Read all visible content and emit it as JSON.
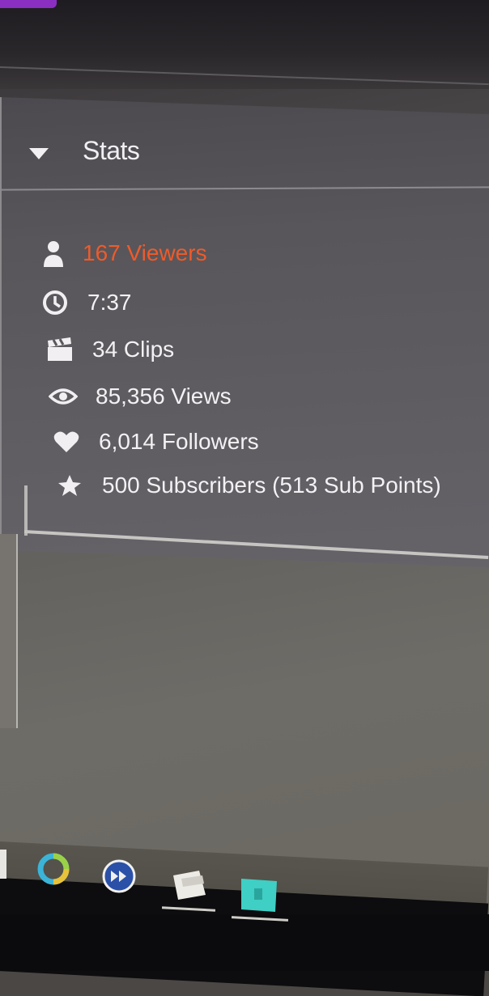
{
  "panel": {
    "title": "Stats",
    "toggle_icon": "caret-down-icon"
  },
  "stats": {
    "viewers": {
      "label": "167 Viewers",
      "icon": "person-icon",
      "color": "#f05a2a"
    },
    "uptime": {
      "label": "7:37",
      "icon": "clock-icon"
    },
    "clips": {
      "label": "34 Clips",
      "icon": "clapperboard-icon"
    },
    "views": {
      "label": "85,356 Views",
      "icon": "eye-icon"
    },
    "followers": {
      "label": "6,014 Followers",
      "icon": "heart-icon"
    },
    "subscribers": {
      "label": "500 Subscribers (513 Sub Points)",
      "icon": "star-icon"
    }
  },
  "taskbar": {
    "apps": [
      "ring-app-icon",
      "media-app-icon",
      "folder-app-icon",
      "teal-app-icon"
    ]
  }
}
